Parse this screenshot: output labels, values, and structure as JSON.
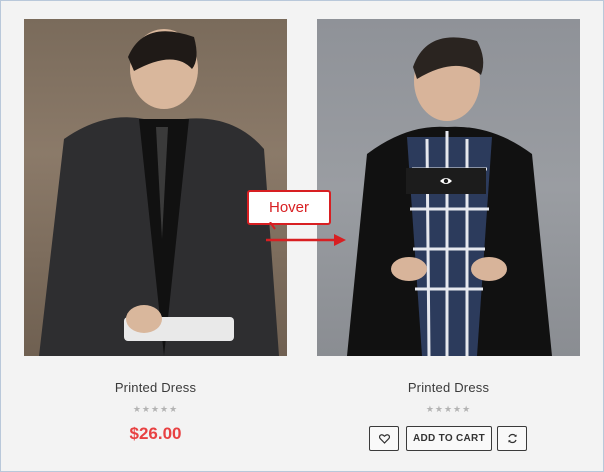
{
  "products": [
    {
      "name": "Printed Dress",
      "rating": "★★★★★",
      "price": "$26.00"
    },
    {
      "name": "Printed Dress",
      "rating": "★★★★★",
      "actions": {
        "wishlist_icon": "heart-icon",
        "add_to_cart_label": "ADD TO CART",
        "compare_icon": "refresh-icon"
      },
      "quick_view_icon": "eye-icon"
    }
  ],
  "annotation": {
    "label": "Hover",
    "color": "#d81f22"
  }
}
